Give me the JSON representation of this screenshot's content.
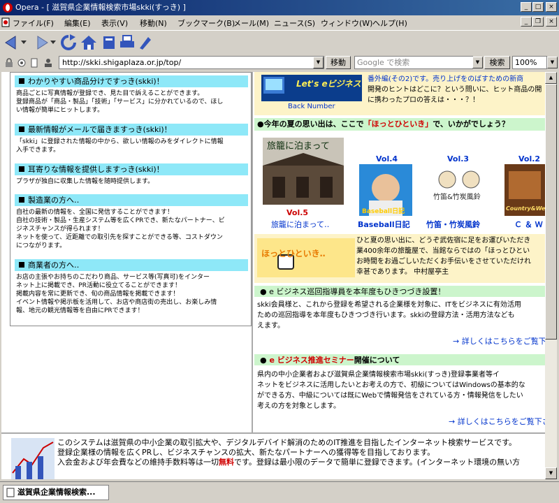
{
  "window": {
    "title": "Opera - [ 滋賀県企業情報検索市場skki(すっき) ]",
    "controls": {
      "minimize": "_",
      "maximize": "□",
      "close": "×"
    }
  },
  "menu": {
    "items": [
      {
        "label": "ファイル(F)"
      },
      {
        "label": "編集(E)"
      },
      {
        "label": "表示(V)"
      },
      {
        "label": "移動(N)"
      },
      {
        "label": "ブックマーク(B)"
      },
      {
        "label": "メール(M)"
      },
      {
        "label": "ニュース(S)"
      },
      {
        "label": "ウィンドウ(W)"
      },
      {
        "label": "ヘルプ(H)"
      }
    ]
  },
  "address": {
    "url": "http://skki.shigaplaza.or.jp/top/",
    "go_label": "移動",
    "search_placeholder": "Google で検索",
    "search_label": "検索",
    "zoom": "100%"
  },
  "left_panel": {
    "sections": [
      {
        "title": "わかりやすい商品分けですっき(skki)！",
        "lines": [
          "商品ごとに写真情報が登録でき、見た目で訴えることができます。",
          "登録商品が「商品・製品」「技術」「サービス」に分かれているので、ほし",
          "い情報が簡単にヒットします。"
        ]
      },
      {
        "title": "最新情報がメールで届きますっき(skki)！",
        "lines": [
          "「skki」に登録された情報の中から、欲しい情報のみをダイレクトに情報",
          "入手できます。"
        ]
      },
      {
        "title": "耳寄りな情報を提供しますっき(skki)！",
        "lines": [
          "プラザが独自に収集した情報を随時提供します。"
        ]
      },
      {
        "title": "製造業の方へ‥",
        "lines": [
          "自社の最新の情報を、全国に発信することができます！",
          "自社の技術・製品・生産システム等を広くPRでき、新たなパートナー、ビ",
          "ジネスチャンスが得られます！",
          "ネットを使って、近距離での取引先を探すことができる等、コストダウン",
          "につながります。"
        ]
      },
      {
        "title": "商業者の方へ‥",
        "lines": [
          "お店の主張やお持ちのこだわり商品、サービス等(写真可)をインター",
          "ネット上に掲載でき、PR活動に役立てることができます！",
          "掲載内容を常に更新でき、旬の商品情報を掲載できます！",
          "イベント情報や掲示板を活用して、お店や商店街の売出し、お楽しみ情",
          "報、地元の観光情報等を自由にPRできます！"
        ]
      }
    ]
  },
  "right_panel": {
    "banner": {
      "title": "Let's eビジネス！",
      "back": "Back Number",
      "lines": [
        "番外編(その2)です。売り上げをのばすための新商",
        "開発のヒントはどこに？という問いに、ヒット商品の開",
        "に携わったプロの答えは・・・？！"
      ]
    },
    "summer": {
      "heading_pre": "●今年の夏の思い出は、ここで",
      "heading_em": "「ほっとひといき」",
      "heading_post": "で、いかがでしょう？"
    },
    "volumes": [
      {
        "vol": "Vol.5",
        "caption": "旅籠に泊まって‥",
        "label": "旅籠に泊まって"
      },
      {
        "vol": "Vol.4",
        "caption": "Baseball日記",
        "label": "Baseball日記"
      },
      {
        "vol": "Vol.3",
        "caption": "竹笛・竹炭風鈴",
        "label": "竹笛&竹炭風鈴"
      },
      {
        "vol": "Vol.2",
        "caption": "Ｃ ＆ Ｗ",
        "label": "Country&West"
      }
    ],
    "hotto": {
      "logo": "ほっとひといき‥",
      "lines": [
        "ひと夏の思い出に、どうぞ武佐宿に足をお運びいただき",
        "業400余年の旅籠屋で、当館ならではの「ほっとひとい",
        "お時間をお過ごしいただくお手伝いをさせていただけれ",
        "幸甚であります。 中村屋亭主"
      ]
    },
    "news1": {
      "title": "● e ビジネス巡回指導員を本年度もひきつづき設置！",
      "lines": [
        "skki会員様と、これから登録を希望される企業様を対象に、ITをビジネスに有効活用",
        "ための巡回指導を本年度もひきつづき行います。skkiの登録方法・活用方法なども",
        "えます。"
      ],
      "more": "→ 詳しくはこちらをご覧下"
    },
    "news2": {
      "title_em": "e ビジネス推進セミナー",
      "title_post": "開催について",
      "lines": [
        "県内の中小企業者および滋賀県企業情報検索市場skki(すっき)登録事業者等イ",
        "ネットをビジネスに活用したいとお考えの方で、初級についてはWindowsの基本的な",
        "ができる方、中級については既にWebで情報発信をされている方・情報発信をしたい",
        "考えの方を対象とします。"
      ],
      "more": "→ 詳しくはこちらをご覧下さ"
    }
  },
  "bottom": {
    "lines": [
      "このシステムは滋賀県の中小企業の取引拡大や、デジタルデバイド解消のためのIT推進を目指したインターネット検索サービスです。",
      "登録企業様の情報を広くPRし、ビジネスチャンスの拡大、新たなパートナーへの獲得等を目指しております。"
    ],
    "line3_pre": "入会金および年会費などの維持手数料等は一切",
    "line3_em": "無料",
    "line3_post": "です。登録は最小限のデータで簡単に登録できます。(インターネット環境の無い方"
  },
  "status": {
    "tab": "滋賀県企業情報検索..."
  },
  "colors": {
    "section_header": "#8ee8f8",
    "title_bar": "#0a246a",
    "green_header": "#ccf5cc",
    "link_blue": "#0033cc",
    "accent_red": "#d00000"
  }
}
